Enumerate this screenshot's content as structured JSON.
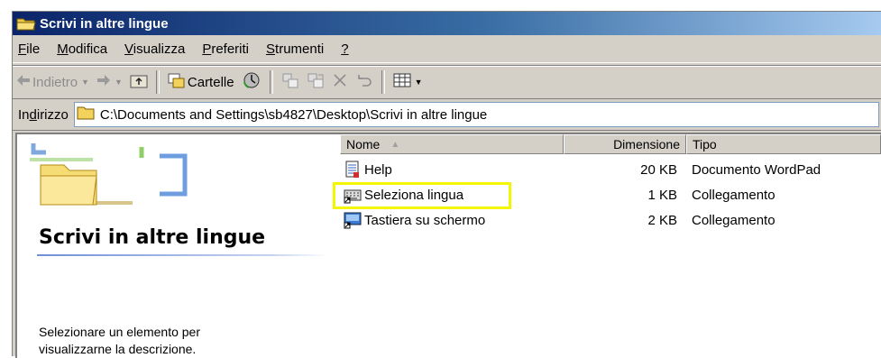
{
  "window": {
    "title": "Scrivi in altre lingue",
    "title_icon": "folder-open-icon"
  },
  "menubar": {
    "items": [
      {
        "label": "File",
        "underline": "F"
      },
      {
        "label": "Modifica",
        "underline": "M"
      },
      {
        "label": "Visualizza",
        "underline": "V"
      },
      {
        "label": "Preferiti",
        "underline": "P"
      },
      {
        "label": "Strumenti",
        "underline": "S"
      },
      {
        "label": "?",
        "underline": "?"
      }
    ]
  },
  "toolbar": {
    "back_label": "Indietro",
    "folders_label": "Cartelle"
  },
  "addressbar": {
    "label": "Indirizzo",
    "path": "C:\\Documents and Settings\\sb4827\\Desktop\\Scrivi in altre lingue"
  },
  "leftpane": {
    "title": "Scrivi in altre lingue",
    "description_line1": "Selezionare un elemento per",
    "description_line2": "visualizzarne la descrizione."
  },
  "filelist": {
    "columns": {
      "name": "Nome",
      "size": "Dimensione",
      "type": "Tipo"
    },
    "rows": [
      {
        "name": "Help",
        "size": "20 KB",
        "type": "Documento WordPad",
        "icon": "wordpad-document-icon"
      },
      {
        "name": "Seleziona lingua",
        "size": "1 KB",
        "type": "Collegamento",
        "icon": "shortcut-keyboard-icon",
        "highlighted": true
      },
      {
        "name": "Tastiera su schermo",
        "size": "2 KB",
        "type": "Collegamento",
        "icon": "onscreen-keyboard-icon"
      }
    ]
  },
  "colors": {
    "titlebar_start": "#0a246a",
    "titlebar_end": "#a6caf0",
    "window_bg": "#d4d0c8",
    "highlight_box": "#f5f500"
  }
}
